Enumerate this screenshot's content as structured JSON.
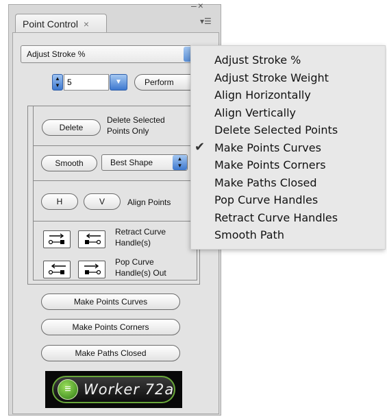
{
  "panel": {
    "tab_label": "Point Control",
    "tab_close": "×",
    "window_controls": "–×",
    "menu_glyph": "▾☰"
  },
  "action": {
    "selected": "Adjust Stroke  %",
    "value": "5",
    "perform_label": "Perform"
  },
  "delete_group": {
    "button": "Delete",
    "label_line1": "Delete Selected",
    "label_line2": "Points Only"
  },
  "smooth_group": {
    "button": "Smooth",
    "shape_option": "Best Shape"
  },
  "align_group": {
    "h_button": "H",
    "v_button": "V",
    "label": "Align Points"
  },
  "handles_group": {
    "retract_line1": "Retract Curve",
    "retract_line2": "Handle(s)",
    "pop_line1": "Pop Curve",
    "pop_line2": "Handle(s) Out"
  },
  "buttons": {
    "curves": "Make Points Curves",
    "corners": "Make Points Corners",
    "closed": "Make Paths Closed"
  },
  "logo": {
    "text": "Worker 72a",
    "glyph": "≡"
  },
  "menu": {
    "items": [
      "Adjust Stroke  %",
      "Adjust Stroke Weight",
      "Align Horizontally",
      "Align Vertically",
      "Delete Selected Points",
      "Make Points Curves",
      "Make Points Corners",
      "Make Paths Closed",
      "Pop Curve Handles",
      "Retract Curve Handles",
      "Smooth Path"
    ],
    "checked_item": "Make Points Curves",
    "check_glyph": "✔"
  },
  "colors": {
    "accent_blue": "#3d78cf",
    "panel_bg": "#d8d8d8",
    "logo_green": "#6aa83a"
  }
}
